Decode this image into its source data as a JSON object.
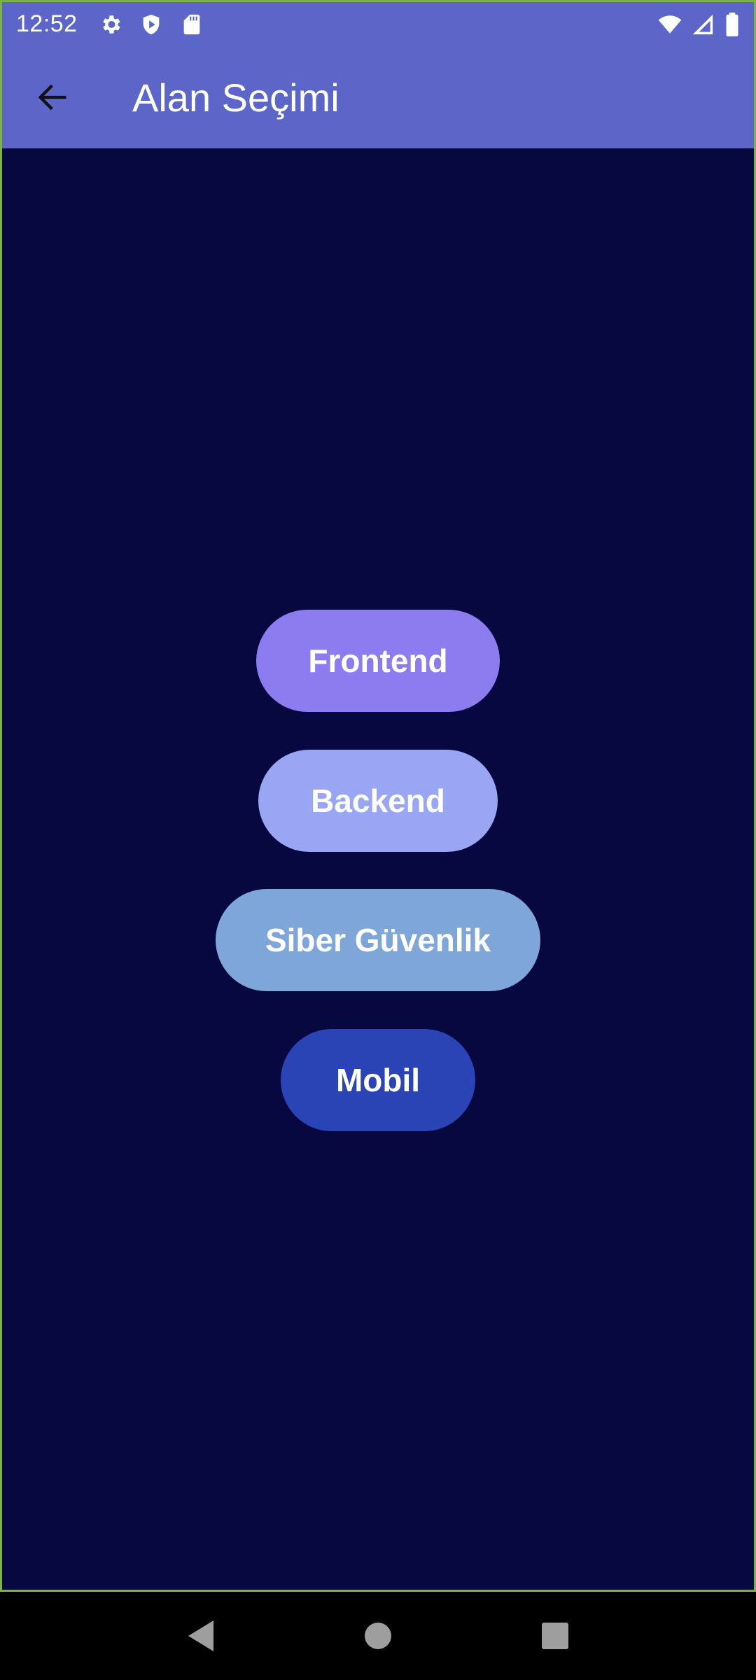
{
  "status_bar": {
    "time": "12:52",
    "left_icons": [
      "settings-icon",
      "shield-play-icon",
      "sd-card-icon"
    ],
    "right_icons": [
      "wifi-icon",
      "cell-signal-icon",
      "battery-icon"
    ]
  },
  "app_bar": {
    "back_icon": "arrow-left-icon",
    "title": "Alan Seçimi"
  },
  "choices": [
    {
      "label": "Frontend",
      "color": "#8c7cf0"
    },
    {
      "label": "Backend",
      "color": "#99a6f3"
    },
    {
      "label": "Siber Güvenlik",
      "color": "#7fa6d8"
    },
    {
      "label": "Mobil",
      "color": "#2a44b6"
    }
  ],
  "colors": {
    "app_bar": "#5b66c8",
    "background": "#07083f",
    "frame_border": "#7cb342"
  },
  "nav_bar": {
    "icons": [
      "nav-back-icon",
      "nav-home-icon",
      "nav-recents-icon"
    ]
  }
}
